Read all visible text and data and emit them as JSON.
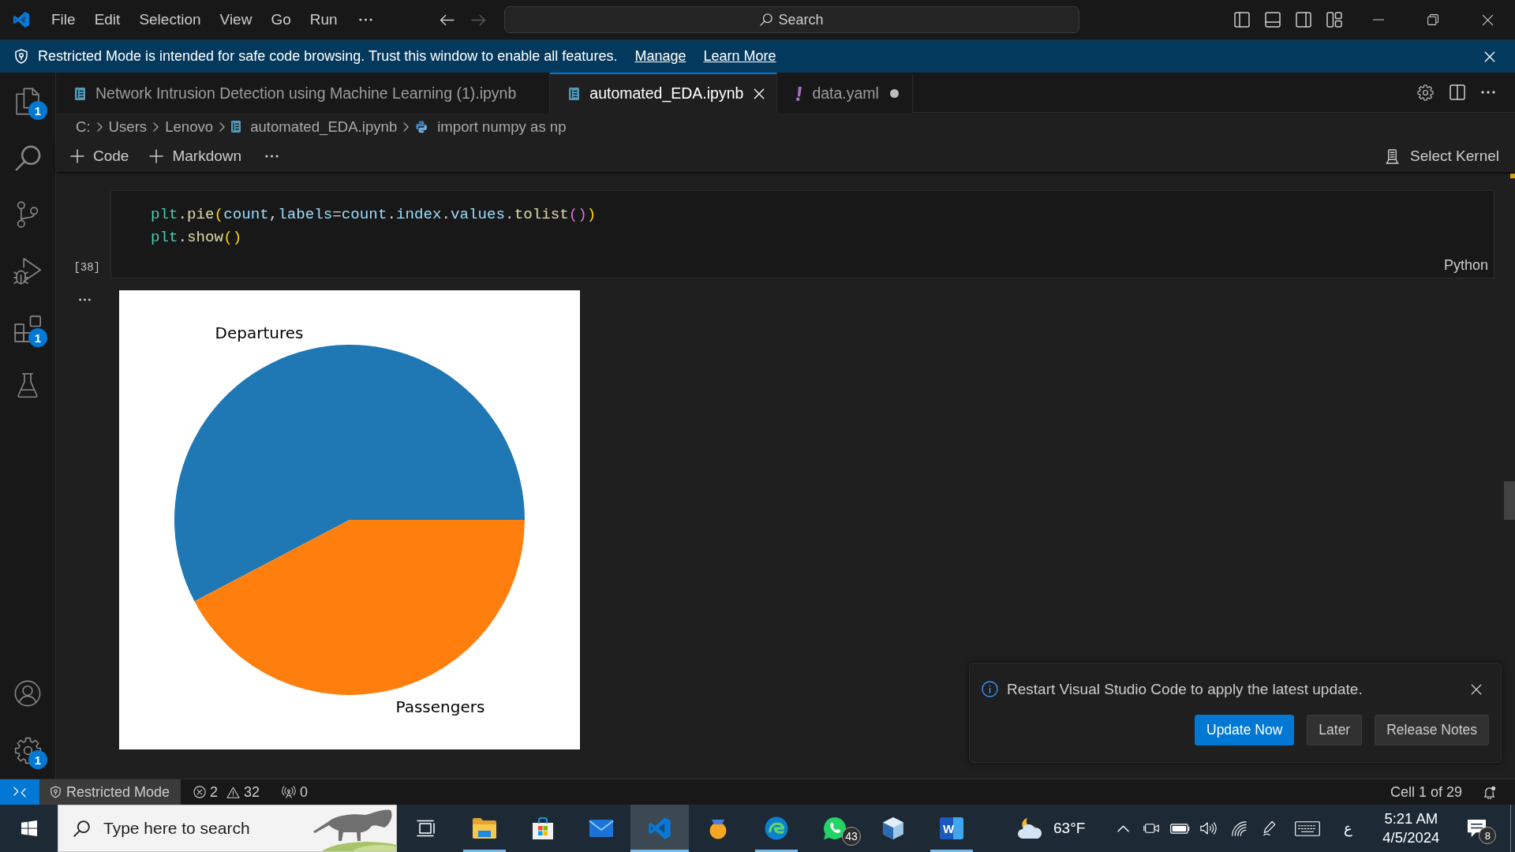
{
  "title_bar": {
    "menus": [
      "File",
      "Edit",
      "Selection",
      "View",
      "Go",
      "Run"
    ],
    "navigation": [
      {
        "kind": "back",
        "disabled": false
      },
      {
        "kind": "forward",
        "disabled": true
      }
    ],
    "command_center": "Search"
  },
  "banner": {
    "message": "Restricted Mode is intended for safe code browsing. Trust this window to enable all features.",
    "links": [
      "Manage",
      "Learn More"
    ]
  },
  "activity_bar": {
    "items": [
      {
        "kind": "explorer",
        "badge": "1",
        "selected": false
      },
      {
        "kind": "search",
        "selected": false
      },
      {
        "kind": "source_control",
        "selected": false
      },
      {
        "kind": "run_debug",
        "selected": false
      },
      {
        "kind": "extensions",
        "badge": "1",
        "selected": false
      },
      {
        "kind": "testing",
        "selected": false
      }
    ],
    "bottom": [
      {
        "kind": "accounts"
      },
      {
        "kind": "manage",
        "badge": "1"
      }
    ]
  },
  "tabs": [
    {
      "label": "Network Intrusion Detection using Machine Learning (1).ipynb",
      "kind": "notebook",
      "selected": false,
      "dirty": false
    },
    {
      "label": "automated_EDA.ipynb",
      "kind": "notebook",
      "selected": true,
      "dirty": false
    },
    {
      "label": "data.yaml",
      "kind": "yaml",
      "selected": false,
      "dirty": true
    }
  ],
  "breadcrumbs": [
    {
      "label": "C:",
      "kind": "folder"
    },
    {
      "label": "Users",
      "kind": "folder"
    },
    {
      "label": "Lenovo",
      "kind": "folder"
    },
    {
      "label": "automated_EDA.ipynb",
      "kind": "notebook"
    },
    {
      "label": "import numpy as np",
      "kind": "python"
    }
  ],
  "notebook_toolbar": {
    "actions": [
      "Code",
      "Markdown"
    ],
    "kernel": "Select Kernel"
  },
  "cell": {
    "lines": [
      {
        "tokens": [
          {
            "text": "plt",
            "kind": "class"
          },
          {
            "text": ".",
            "kind": "punct"
          },
          {
            "text": "pie",
            "kind": "func"
          },
          {
            "text": "(",
            "kind": "bracket1"
          },
          {
            "text": "count",
            "kind": "var"
          },
          {
            "text": ",",
            "kind": "punct"
          },
          {
            "text": "labels",
            "kind": "var"
          },
          {
            "text": "=",
            "kind": "punct"
          },
          {
            "text": "count",
            "kind": "var"
          },
          {
            "text": ".",
            "kind": "punct"
          },
          {
            "text": "index",
            "kind": "var"
          },
          {
            "text": ".",
            "kind": "punct"
          },
          {
            "text": "values",
            "kind": "var"
          },
          {
            "text": ".",
            "kind": "punct"
          },
          {
            "text": "tolist",
            "kind": "func"
          },
          {
            "text": "()",
            "kind": "bracket2"
          },
          {
            "text": ")",
            "kind": "bracket1"
          }
        ]
      },
      {
        "tokens": [
          {
            "text": "plt",
            "kind": "class"
          },
          {
            "text": ".",
            "kind": "punct"
          },
          {
            "text": "show",
            "kind": "func"
          },
          {
            "text": "()",
            "kind": "bracket1"
          }
        ]
      }
    ],
    "execution_count": "[38]",
    "language": "Python",
    "output": {
      "chart_data": {
        "type": "pie",
        "categories": [
          "Departures",
          "Passengers"
        ],
        "values": [
          57.7,
          42.3
        ]
      }
    }
  },
  "notification": {
    "message": "Restart Visual Studio Code to apply the latest update.",
    "buttons": [
      {
        "label": "Update Now",
        "primary": true
      },
      {
        "label": "Later",
        "primary": false
      },
      {
        "label": "Release Notes",
        "primary": false
      }
    ]
  },
  "status_bar": {
    "restricted_mode": "Restricted Mode",
    "errors": "2",
    "warnings": "32",
    "ports": "0",
    "cell_position": "Cell 1 of 29"
  },
  "taskbar": {
    "search": {
      "placeholder": "Type here to search"
    },
    "apps": [
      {
        "kind": "task_view",
        "running": false,
        "selected": false
      },
      {
        "kind": "file_explorer",
        "running": true,
        "selected": false
      },
      {
        "kind": "store",
        "running": false,
        "selected": false
      },
      {
        "kind": "mail",
        "running": false,
        "selected": false
      },
      {
        "kind": "vscode",
        "running": true,
        "selected": true
      },
      {
        "kind": "medal",
        "running": false,
        "selected": false
      },
      {
        "kind": "edge",
        "running": true,
        "selected": false
      },
      {
        "kind": "whatsapp",
        "running": false,
        "selected": false,
        "badge": "43"
      },
      {
        "kind": "virtualbox",
        "running": false,
        "selected": false
      },
      {
        "kind": "word",
        "running": true,
        "selected": false,
        "letter": "W"
      }
    ],
    "weather": "63°F",
    "language": "ع",
    "time": "5:21 AM",
    "date": "4/5/2024",
    "notifications": "8"
  }
}
